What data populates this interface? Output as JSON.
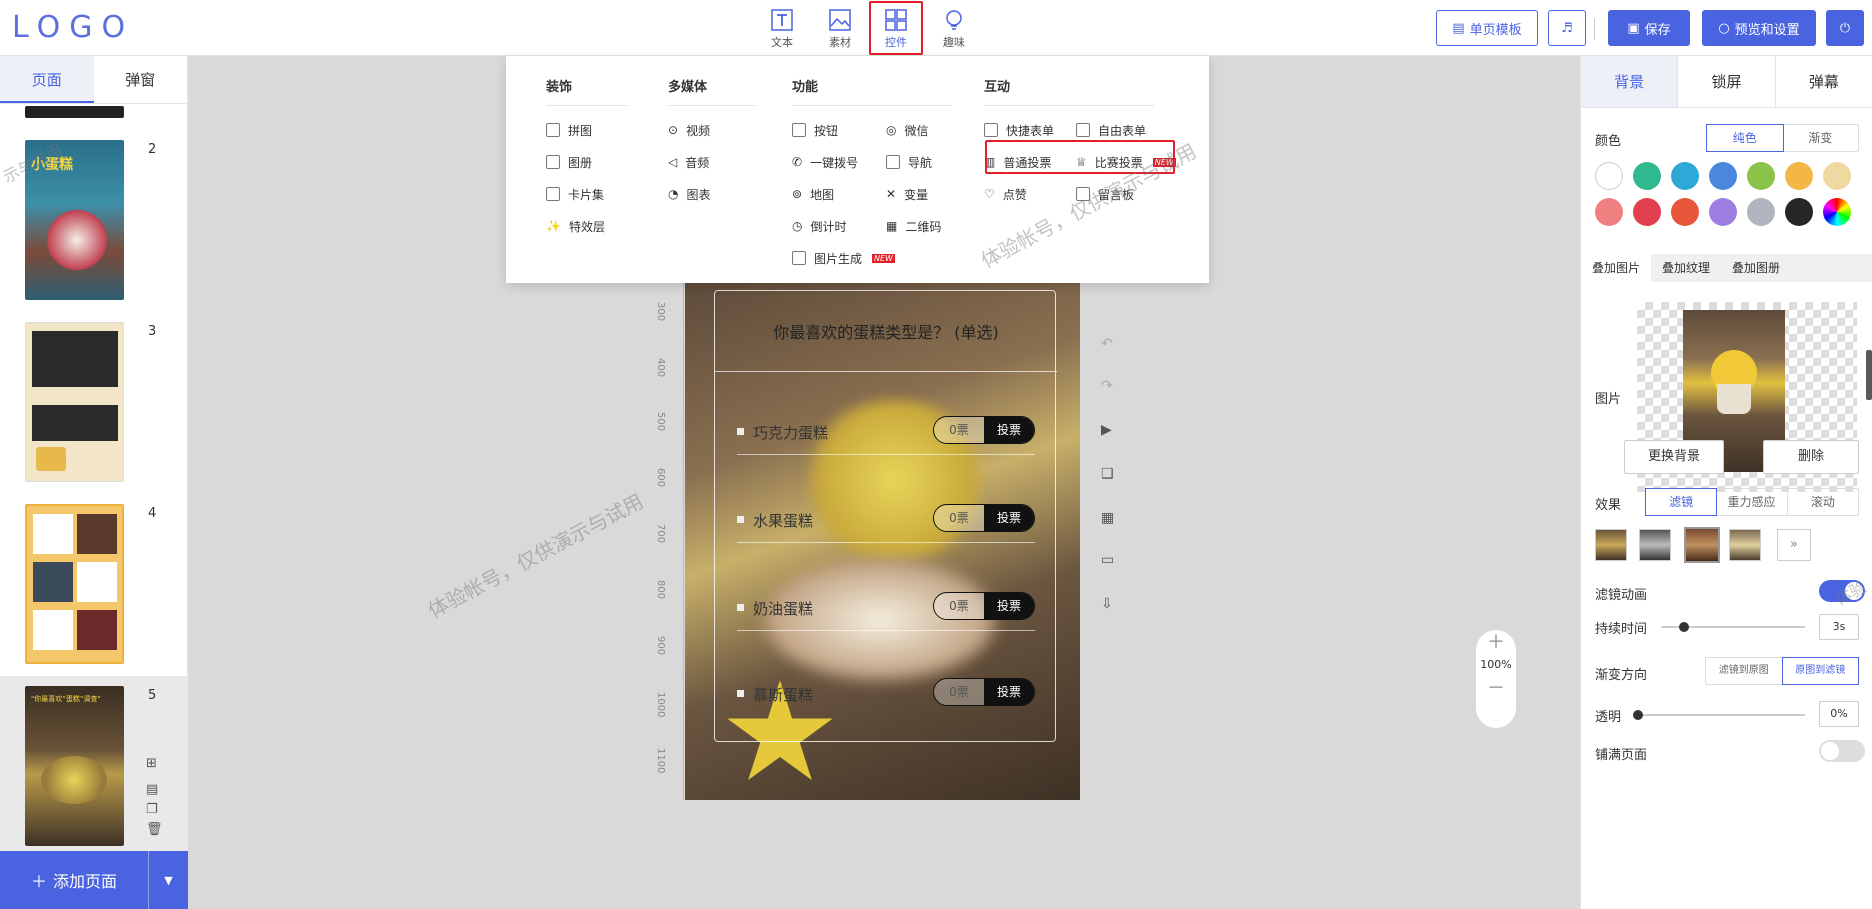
{
  "logo": "LOGO",
  "toolbar": {
    "tools": [
      {
        "label": "文本",
        "icon": "text-icon"
      },
      {
        "label": "素材",
        "icon": "image-icon"
      },
      {
        "label": "控件",
        "icon": "grid-icon"
      },
      {
        "label": "趣味",
        "icon": "bulb-icon"
      }
    ],
    "template_btn": "单页模板",
    "save_btn": "保存",
    "preview_btn": "预览和设置"
  },
  "left": {
    "tabs": [
      "页面",
      "弹窗"
    ],
    "page_numbers": [
      "2",
      "3",
      "4",
      "5"
    ],
    "thumb2_title": "小蛋糕",
    "thumb5_title": "\"你最喜欢“蛋糕”调查\"",
    "add_page": "添加页面"
  },
  "dropdown": {
    "decor": {
      "title": "装饰",
      "items": [
        "拼图",
        "图册",
        "卡片集",
        "特效层"
      ]
    },
    "media": {
      "title": "多媒体",
      "items": [
        "视频",
        "音频",
        "图表"
      ]
    },
    "func": {
      "title": "功能",
      "items": [
        "按钮",
        "微信",
        "一键拨号",
        "导航",
        "地图",
        "变量",
        "倒计时",
        "二维码",
        "图片生成"
      ]
    },
    "interact": {
      "title": "互动",
      "items": [
        "快捷表单",
        "自由表单",
        "普通投票",
        "比赛投票",
        "点赞",
        "留言板"
      ]
    },
    "new_tag": "NEW"
  },
  "poll": {
    "question": "你最喜欢的蛋糕类型是？ (单选)",
    "options": [
      {
        "label": "巧克力蛋糕",
        "count": "0票",
        "btn": "投票"
      },
      {
        "label": "水果蛋糕",
        "count": "0票",
        "btn": "投票"
      },
      {
        "label": "奶油蛋糕",
        "count": "0票",
        "btn": "投票"
      },
      {
        "label": "慕斯蛋糕",
        "count": "0票",
        "btn": "投票"
      }
    ]
  },
  "ruler": [
    "300",
    "400",
    "500",
    "600",
    "700",
    "800",
    "900",
    "1000",
    "1100"
  ],
  "zoom": {
    "level": "100%"
  },
  "right": {
    "tabs": [
      "背景",
      "锁屏",
      "弹幕"
    ],
    "color_label": "颜色",
    "color_modes": [
      "纯色",
      "渐变"
    ],
    "swatches": [
      "#ffffff",
      "#2fb98e",
      "#2da9d8",
      "#4a88dd",
      "#8bc34a",
      "#f3b844",
      "#f0d9a0",
      "#f08080",
      "#e04050",
      "#e8553a",
      "#9c7fe0",
      "#b0b4be",
      "#262626"
    ],
    "sub_tabs": [
      "叠加图片",
      "叠加纹理",
      "叠加图册"
    ],
    "image_label": "图片",
    "change_bg": "更换背景",
    "delete": "删除",
    "effect_label": "效果",
    "effect_modes": [
      "滤镜",
      "重力感应",
      "滚动"
    ],
    "filter_anim": "滤镜动画",
    "duration_label": "持续时间",
    "duration_value": "3s",
    "direction_label": "渐变方向",
    "directions": [
      "滤镜到原图",
      "原图到滤镜"
    ],
    "opacity_label": "透明",
    "opacity_value": "0%",
    "fill_label": "铺满页面"
  },
  "watermark": "体验帐号，仅供演示与试用",
  "watermark_short": "示与试用",
  "watermark_edge": "体验"
}
